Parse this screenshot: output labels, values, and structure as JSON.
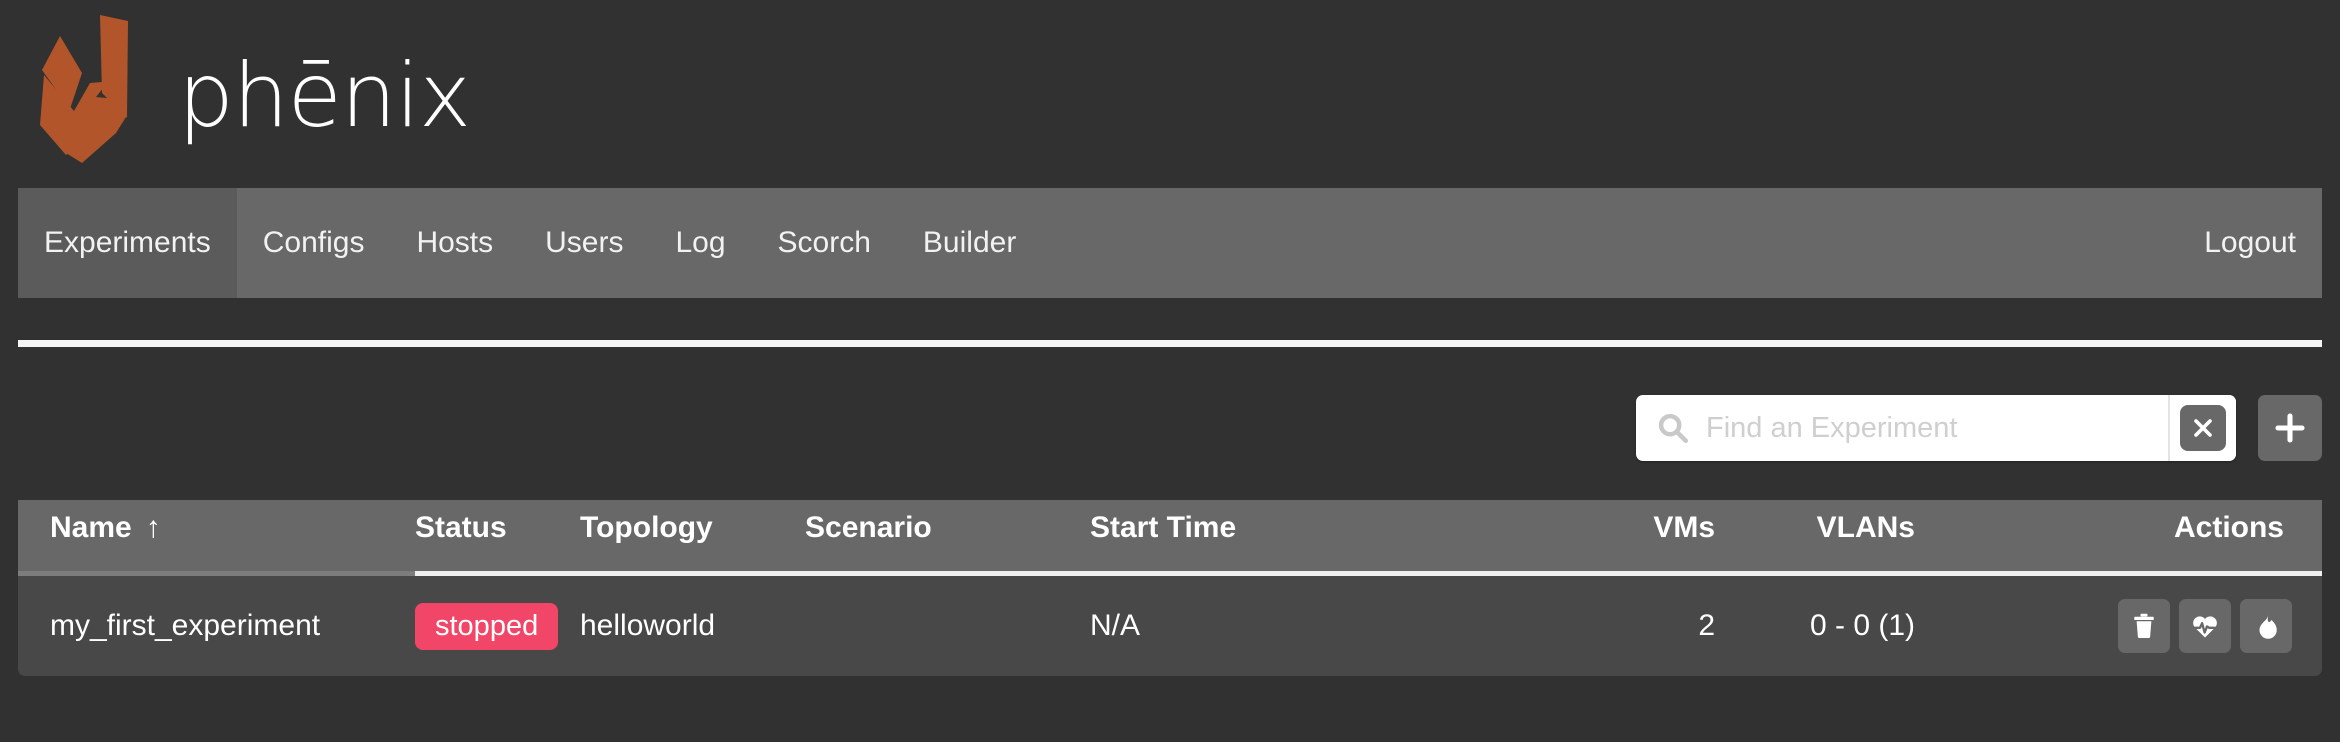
{
  "brand": {
    "name": "phēnix",
    "logo_icon": "phoenix-bird-logo",
    "logo_color": "#b2552b"
  },
  "nav": {
    "items": [
      {
        "label": "Experiments",
        "active": true
      },
      {
        "label": "Configs",
        "active": false
      },
      {
        "label": "Hosts",
        "active": false
      },
      {
        "label": "Users",
        "active": false
      },
      {
        "label": "Log",
        "active": false
      },
      {
        "label": "Scorch",
        "active": false
      },
      {
        "label": "Builder",
        "active": false
      }
    ],
    "logout_label": "Logout"
  },
  "toolbar": {
    "search_placeholder": "Find an Experiment",
    "search_value": "",
    "search_icon": "search-icon",
    "clear_icon": "close-x-icon",
    "add_icon": "plus-icon"
  },
  "table": {
    "columns": [
      {
        "label": "Name",
        "sorted": true,
        "sort_arrow": "↑"
      },
      {
        "label": "Status",
        "sorted": false,
        "sort_arrow": ""
      },
      {
        "label": "Topology",
        "sorted": false,
        "sort_arrow": ""
      },
      {
        "label": "Scenario",
        "sorted": false,
        "sort_arrow": ""
      },
      {
        "label": "Start Time",
        "sorted": false,
        "sort_arrow": ""
      },
      {
        "label": "VMs",
        "sorted": false,
        "sort_arrow": ""
      },
      {
        "label": "VLANs",
        "sorted": false,
        "sort_arrow": ""
      },
      {
        "label": "Actions",
        "sorted": false,
        "sort_arrow": ""
      }
    ],
    "rows": [
      {
        "name": "my_first_experiment",
        "status": "stopped",
        "status_color": "#f14668",
        "topology": "helloworld",
        "scenario": "",
        "start_time": "N/A",
        "vms": "2",
        "vlans": "0 - 0 (1)",
        "actions": [
          {
            "icon": "trash-icon",
            "title": "Delete"
          },
          {
            "icon": "heartbeat-icon",
            "title": "Status"
          },
          {
            "icon": "flame-icon",
            "title": "Start"
          }
        ]
      }
    ]
  }
}
